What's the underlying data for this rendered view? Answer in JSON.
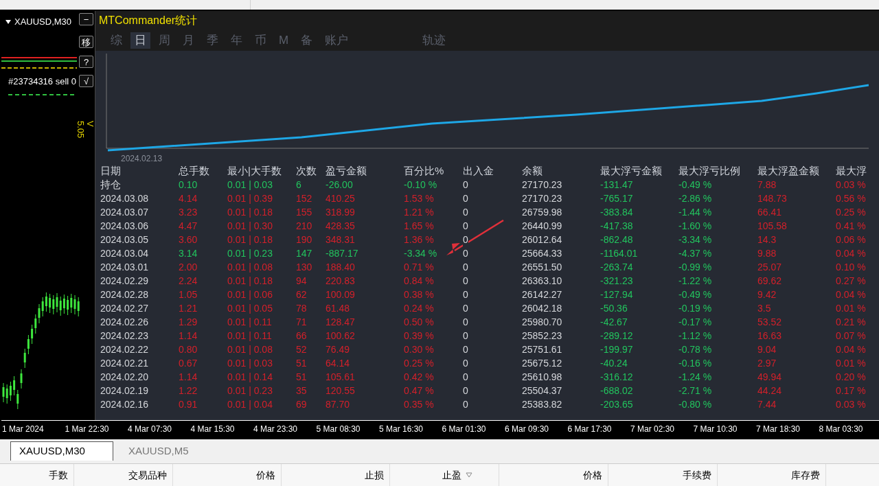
{
  "chart_window": {
    "symbol": "XAUUSD,M30",
    "buttons": [
      "−",
      "移",
      "?",
      "√"
    ],
    "order_label": "#23734316 sell 0",
    "version": "V 5.05"
  },
  "stats_panel": {
    "title": "MTCommander统计",
    "tabs": [
      {
        "label": "综",
        "selected": false
      },
      {
        "label": "日",
        "selected": true
      },
      {
        "label": "周",
        "selected": false
      },
      {
        "label": "月",
        "selected": false
      },
      {
        "label": "季",
        "selected": false
      },
      {
        "label": "年",
        "selected": false
      },
      {
        "label": "币",
        "selected": false
      },
      {
        "label": "M",
        "selected": false
      },
      {
        "label": "备",
        "selected": false
      },
      {
        "label": "账户",
        "selected": false
      }
    ],
    "side_tabs": [
      {
        "label": "轨迹",
        "selected": false
      }
    ],
    "equity_chart": {
      "start_label": "2024.02.13"
    },
    "table": {
      "columns": [
        "日期",
        "总手数",
        "最小|大手数",
        "次数",
        "盈亏金额",
        "百分比%",
        "出入金",
        "余额",
        "最大浮亏金额",
        "最大浮亏比例",
        "最大浮盈金额",
        "最大浮"
      ],
      "rows": [
        {
          "loss": true,
          "cells": [
            "持仓",
            "0.10",
            "0.01 | 0.03",
            "6",
            "-26.00",
            "-0.10 %",
            "0",
            "27170.23",
            "-131.47",
            "-0.49 %",
            "7.88",
            "0.03 %"
          ]
        },
        {
          "loss": false,
          "cells": [
            "2024.03.08",
            "4.14",
            "0.01 | 0.39",
            "152",
            "410.25",
            "1.53 %",
            "0",
            "27170.23",
            "-765.17",
            "-2.86 %",
            "148.73",
            "0.56 %"
          ]
        },
        {
          "loss": false,
          "cells": [
            "2024.03.07",
            "3.23",
            "0.01 | 0.18",
            "155",
            "318.99",
            "1.21 %",
            "0",
            "26759.98",
            "-383.84",
            "-1.44 %",
            "66.41",
            "0.25 %"
          ]
        },
        {
          "loss": false,
          "cells": [
            "2024.03.06",
            "4.47",
            "0.01 | 0.30",
            "210",
            "428.35",
            "1.65 %",
            "0",
            "26440.99",
            "-417.38",
            "-1.60 %",
            "105.58",
            "0.41 %"
          ]
        },
        {
          "loss": false,
          "cells": [
            "2024.03.05",
            "3.60",
            "0.01 | 0.18",
            "190",
            "348.31",
            "1.36 %",
            "0",
            "26012.64",
            "-862.48",
            "-3.34 %",
            "14.3",
            "0.06 %"
          ]
        },
        {
          "loss": true,
          "cells": [
            "2024.03.04",
            "3.14",
            "0.01 | 0.23",
            "147",
            "-887.17",
            "-3.34 %",
            "0",
            "25664.33",
            "-1164.01",
            "-4.37 %",
            "9.88",
            "0.04 %"
          ]
        },
        {
          "loss": false,
          "cells": [
            "2024.03.01",
            "2.00",
            "0.01 | 0.08",
            "130",
            "188.40",
            "0.71 %",
            "0",
            "26551.50",
            "-263.74",
            "-0.99 %",
            "25.07",
            "0.10 %"
          ]
        },
        {
          "loss": false,
          "cells": [
            "2024.02.29",
            "2.24",
            "0.01 | 0.18",
            "94",
            "220.83",
            "0.84 %",
            "0",
            "26363.10",
            "-321.23",
            "-1.22 %",
            "69.62",
            "0.27 %"
          ]
        },
        {
          "loss": false,
          "cells": [
            "2024.02.28",
            "1.05",
            "0.01 | 0.06",
            "62",
            "100.09",
            "0.38 %",
            "0",
            "26142.27",
            "-127.94",
            "-0.49 %",
            "9.42",
            "0.04 %"
          ]
        },
        {
          "loss": false,
          "cells": [
            "2024.02.27",
            "1.21",
            "0.01 | 0.05",
            "78",
            "61.48",
            "0.24 %",
            "0",
            "26042.18",
            "-50.36",
            "-0.19 %",
            "3.5",
            "0.01 %"
          ]
        },
        {
          "loss": false,
          "cells": [
            "2024.02.26",
            "1.29",
            "0.01 | 0.11",
            "71",
            "128.47",
            "0.50 %",
            "0",
            "25980.70",
            "-42.67",
            "-0.17 %",
            "53.52",
            "0.21 %"
          ]
        },
        {
          "loss": false,
          "cells": [
            "2024.02.23",
            "1.14",
            "0.01 | 0.11",
            "66",
            "100.62",
            "0.39 %",
            "0",
            "25852.23",
            "-289.12",
            "-1.12 %",
            "16.63",
            "0.07 %"
          ]
        },
        {
          "loss": false,
          "cells": [
            "2024.02.22",
            "0.80",
            "0.01 | 0.08",
            "52",
            "76.49",
            "0.30 %",
            "0",
            "25751.61",
            "-199.97",
            "-0.78 %",
            "9.04",
            "0.04 %"
          ]
        },
        {
          "loss": false,
          "cells": [
            "2024.02.21",
            "0.67",
            "0.01 | 0.03",
            "51",
            "64.14",
            "0.25 %",
            "0",
            "25675.12",
            "-40.24",
            "-0.16 %",
            "2.97",
            "0.01 %"
          ]
        },
        {
          "loss": false,
          "cells": [
            "2024.02.20",
            "1.14",
            "0.01 | 0.14",
            "51",
            "105.61",
            "0.42 %",
            "0",
            "25610.98",
            "-316.12",
            "-1.24 %",
            "49.94",
            "0.20 %"
          ]
        },
        {
          "loss": false,
          "cells": [
            "2024.02.19",
            "1.22",
            "0.01 | 0.23",
            "35",
            "120.55",
            "0.47 %",
            "0",
            "25504.37",
            "-688.02",
            "-2.71 %",
            "44.24",
            "0.17 %"
          ]
        },
        {
          "loss": false,
          "cells": [
            "2024.02.16",
            "0.91",
            "0.01 | 0.04",
            "69",
            "87.70",
            "0.35 %",
            "0",
            "25383.82",
            "-203.65",
            "-0.80 %",
            "7.44",
            "0.03 %"
          ]
        }
      ]
    }
  },
  "time_axis": [
    "1 Mar 2024",
    "1 Mar 22:30",
    "4 Mar 07:30",
    "4 Mar 15:30",
    "4 Mar 23:30",
    "5 Mar 08:30",
    "5 Mar 16:30",
    "6 Mar 01:30",
    "6 Mar 09:30",
    "6 Mar 17:30",
    "7 Mar 02:30",
    "7 Mar 10:30",
    "7 Mar 18:30",
    "8 Mar 03:30"
  ],
  "chart_tabs": [
    {
      "label": "XAUUSD,M30",
      "selected": true
    },
    {
      "label": "XAUUSD,M5",
      "selected": false
    }
  ],
  "terminal_columns": [
    {
      "label": "手数",
      "sorted": false
    },
    {
      "label": "交易品种",
      "sorted": false
    },
    {
      "label": "价格",
      "sorted": false
    },
    {
      "label": "止损",
      "sorted": false
    },
    {
      "label": "止盈",
      "sorted": true
    },
    {
      "label": "价格",
      "sorted": false
    },
    {
      "label": "手续费",
      "sorted": false
    },
    {
      "label": "库存费",
      "sorted": false
    }
  ]
}
